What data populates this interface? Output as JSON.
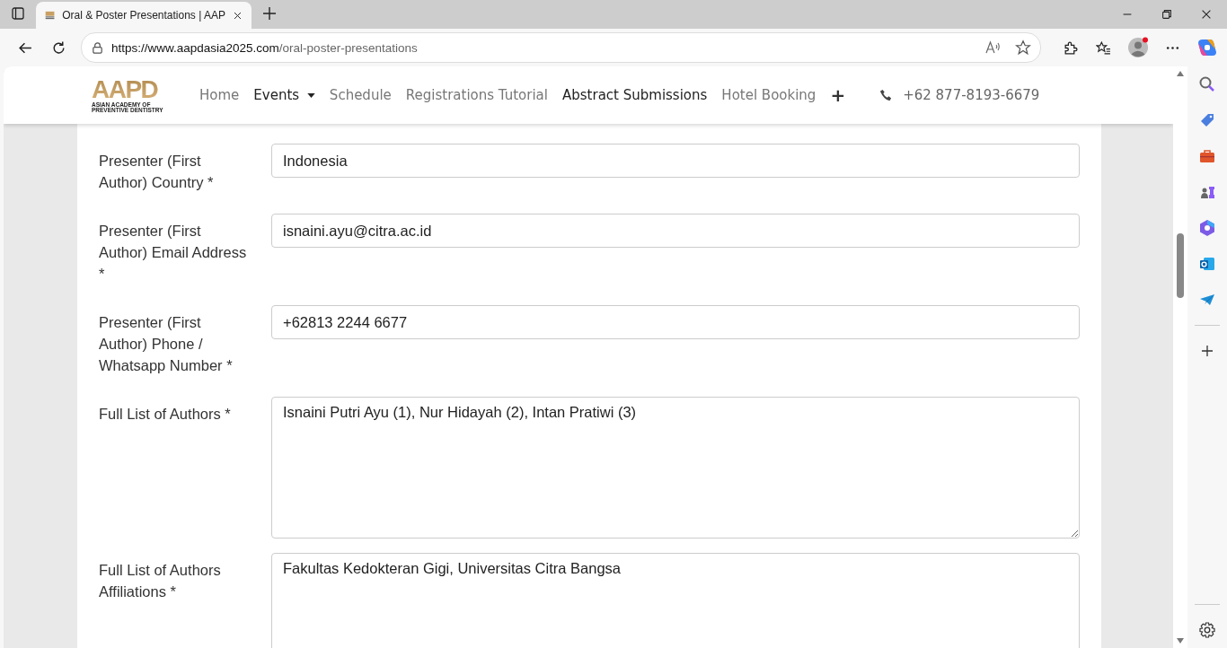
{
  "browser": {
    "tab": {
      "title": "Oral & Poster Presentations | AAP"
    },
    "url": {
      "host": "https://www.aapdasia2025.com",
      "path": "/oral-poster-presentations"
    }
  },
  "site": {
    "logo": {
      "mark": "AAPD",
      "line_1": "ASIAN ACADEMY OF",
      "line_2": "PREVENTIVE DENTISTRY"
    },
    "nav": [
      {
        "label": "Home",
        "kind": "link",
        "selected": false
      },
      {
        "label": "Events",
        "kind": "dropdown",
        "selected": true
      },
      {
        "label": "Schedule",
        "kind": "link",
        "selected": false
      },
      {
        "label": "Registrations Tutorial",
        "kind": "link",
        "selected": false
      },
      {
        "label": "Abstract Submissions",
        "kind": "link",
        "selected": true
      },
      {
        "label": "Hotel Booking",
        "kind": "link",
        "selected": false
      },
      {
        "label": "+",
        "kind": "more",
        "selected": false
      }
    ],
    "phone": "+62 877-8193-6679"
  },
  "form": {
    "fields": [
      {
        "label": "Presenter (First Author) Country *",
        "kind": "input",
        "value": "Indonesia"
      },
      {
        "label": "Presenter (First Author) Email Address *",
        "kind": "input",
        "value": "isnaini.ayu@citra.ac.id"
      },
      {
        "label": "Presenter (First Author) Phone / Whatsapp Number *",
        "kind": "input",
        "value": "+62813 2244 6677"
      },
      {
        "label": "Full List of Authors *",
        "kind": "textarea",
        "value": "Isnaini Putri Ayu (1), Nur Hidayah (2), Intan Pratiwi (3)"
      },
      {
        "label": "Full List of Authors Affiliations *",
        "kind": "textarea",
        "value": "Fakultas Kedokteran Gigi, Universitas Citra Bangsa"
      }
    ]
  }
}
